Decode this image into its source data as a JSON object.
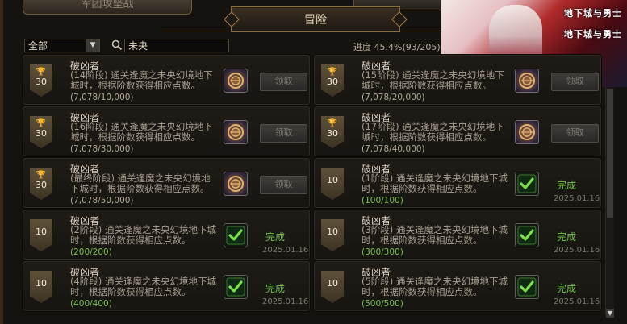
{
  "tabs": {
    "old_tab_label": "军团攻坚战",
    "active_tab_label": "冒险"
  },
  "banner": {
    "logo_text_1": "地下城与勇士",
    "logo_text_2": "地下城与勇士"
  },
  "filter": {
    "category_value": "全部",
    "search_value": "未央",
    "progress_label": "进度 45.4%(93/205)"
  },
  "achievements": [
    {
      "title": "破凶者",
      "desc": "(14阶段) 通关逢魔之未央幻境地下城时，根据阶数获得相应点数。",
      "progress": "(7,078/10,000)",
      "points": "30",
      "status": "claim",
      "button": "领取",
      "date": ""
    },
    {
      "title": "破凶者",
      "desc": "(15阶段) 通关逢魔之未央幻境地下城时，根据阶数获得相应点数。",
      "progress": "(7,078/20,000)",
      "points": "30",
      "status": "claim",
      "button": "领取",
      "date": ""
    },
    {
      "title": "破凶者",
      "desc": "(16阶段) 通关逢魔之未央幻境地下城时，根据阶数获得相应点数。",
      "progress": "(7,078/30,000)",
      "points": "30",
      "status": "claim",
      "button": "领取",
      "date": ""
    },
    {
      "title": "破凶者",
      "desc": "(17阶段) 通关逢魔之未央幻境地下城时，根据阶数获得相应点数。",
      "progress": "(7,078/40,000)",
      "points": "30",
      "status": "claim",
      "button": "领取",
      "date": ""
    },
    {
      "title": "破凶者",
      "desc": "(最终阶段) 通关逢魔之未央幻境地下城时，根据阶数获得相应点数。",
      "progress": "(7,078/50,000)",
      "points": "30",
      "status": "claim",
      "button": "领取",
      "date": ""
    },
    {
      "title": "破凶者",
      "desc": "(1阶段) 通关逢魔之未央幻境地下城时，根据阶数获得相应点数。",
      "progress": "(100/100)",
      "points": "10",
      "status": "done",
      "button": "完成",
      "date": "2025.01.16"
    },
    {
      "title": "破凶者",
      "desc": "(2阶段) 通关逢魔之未央幻境地下城时，根据阶数获得相应点数。",
      "progress": "(200/200)",
      "points": "10",
      "status": "done",
      "button": "完成",
      "date": "2025.01.16"
    },
    {
      "title": "破凶者",
      "desc": "(3阶段) 通关逢魔之未央幻境地下城时，根据阶数获得相应点数。",
      "progress": "(300/300)",
      "points": "10",
      "status": "done",
      "button": "完成",
      "date": "2025.01.16"
    },
    {
      "title": "破凶者",
      "desc": "(4阶段) 通关逢魔之未央幻境地下城时，根据阶数获得相应点数。",
      "progress": "(400/400)",
      "points": "10",
      "status": "done",
      "button": "完成",
      "date": "2025.01.16"
    },
    {
      "title": "破凶者",
      "desc": "(5阶段) 通关逢魔之未央幻境地下城时，根据阶数获得相应点数。",
      "progress": "(500/500)",
      "points": "10",
      "status": "done",
      "button": "完成",
      "date": "2025.01.16"
    }
  ],
  "colors": {
    "done_green": "#6ec24a",
    "gold_border": "#8a6d3f"
  }
}
